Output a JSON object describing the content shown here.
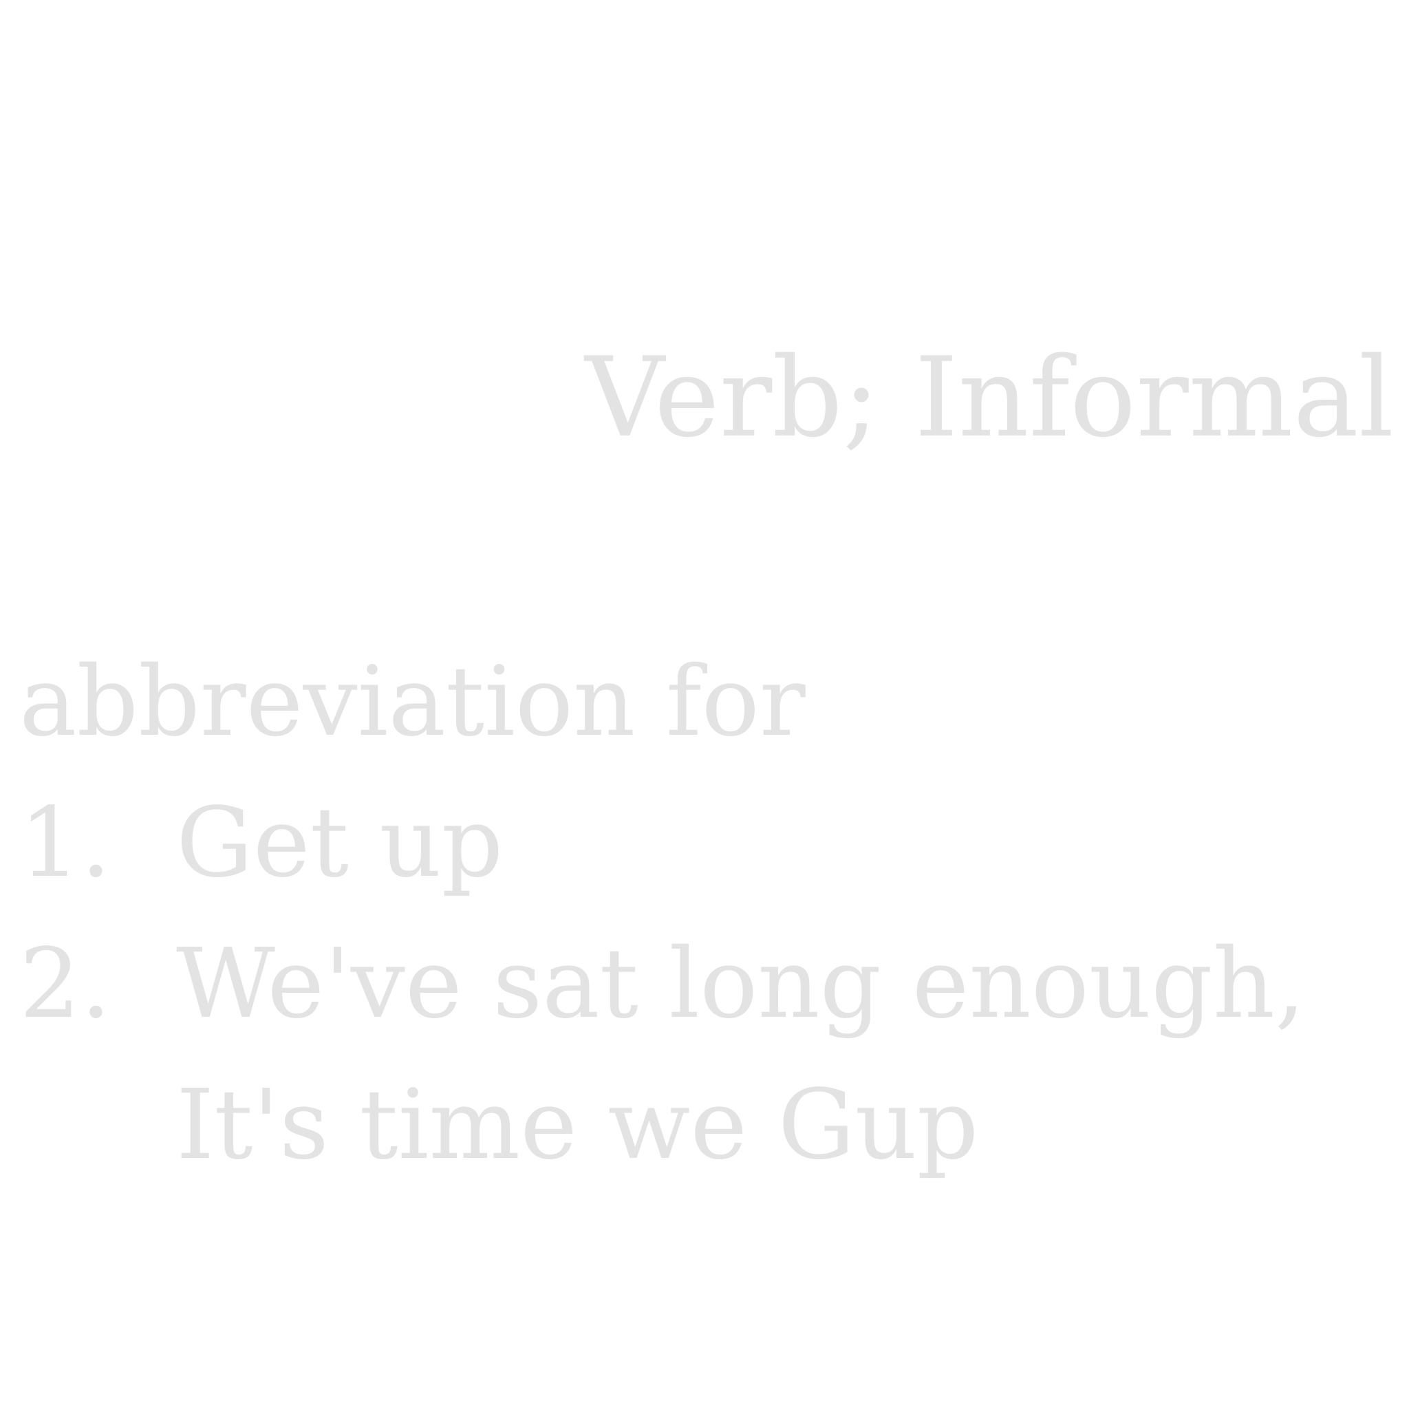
{
  "entry": {
    "part_of_speech": "Verb; Informal",
    "intro": "abbreviation for",
    "senses": [
      {
        "number": "1.",
        "lines": [
          "Get up"
        ]
      },
      {
        "number": "2.",
        "lines": [
          "We've sat long enough,",
          "It's time we Gup"
        ]
      }
    ]
  },
  "colors": {
    "text": "#e3e3e3",
    "background": "#ffffff"
  }
}
